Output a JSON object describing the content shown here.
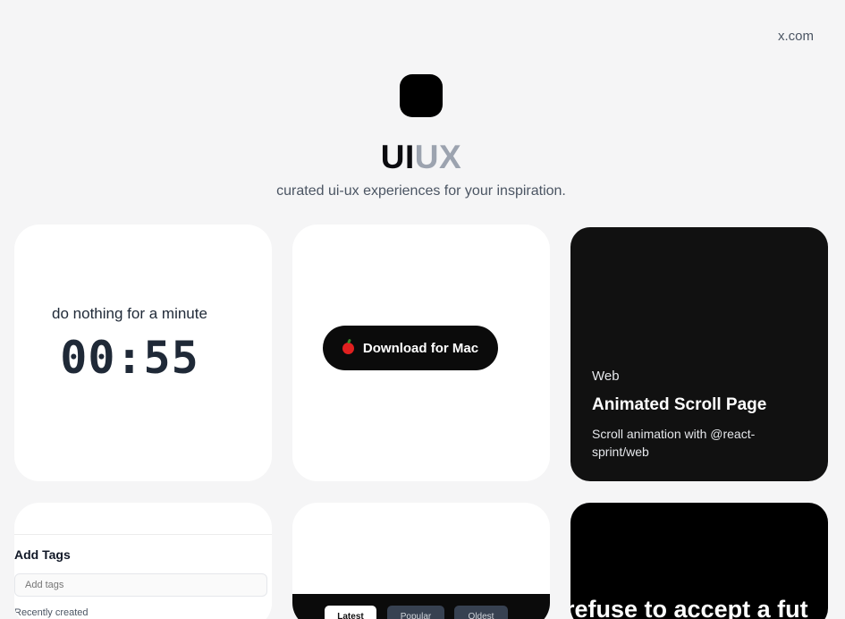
{
  "header": {
    "external_link": "x.com",
    "title_primary": "UI",
    "title_secondary": "UX",
    "tagline": "curated ui-ux experiences for your inspiration."
  },
  "cards": {
    "timer": {
      "label": "do nothing for a minute",
      "time": "00:55"
    },
    "download": {
      "button_label": "Download for Mac",
      "icon": "apple-icon"
    },
    "scroll": {
      "category": "Web",
      "title": "Animated Scroll Page",
      "description": "Scroll animation with @react-sprint/web"
    },
    "tags": {
      "title": "Add Tags",
      "placeholder": "Add tags",
      "recent_label": "Recently created"
    },
    "tabs": {
      "items": [
        "Latest",
        "Popular",
        "Oldest"
      ]
    },
    "marquee": {
      "text": "refuse to accept a fut"
    }
  },
  "colors": {
    "background": "#f5f5f6",
    "dark_card": "#111111",
    "title_muted": "#9ca3af",
    "apple_red": "#e0201f"
  }
}
